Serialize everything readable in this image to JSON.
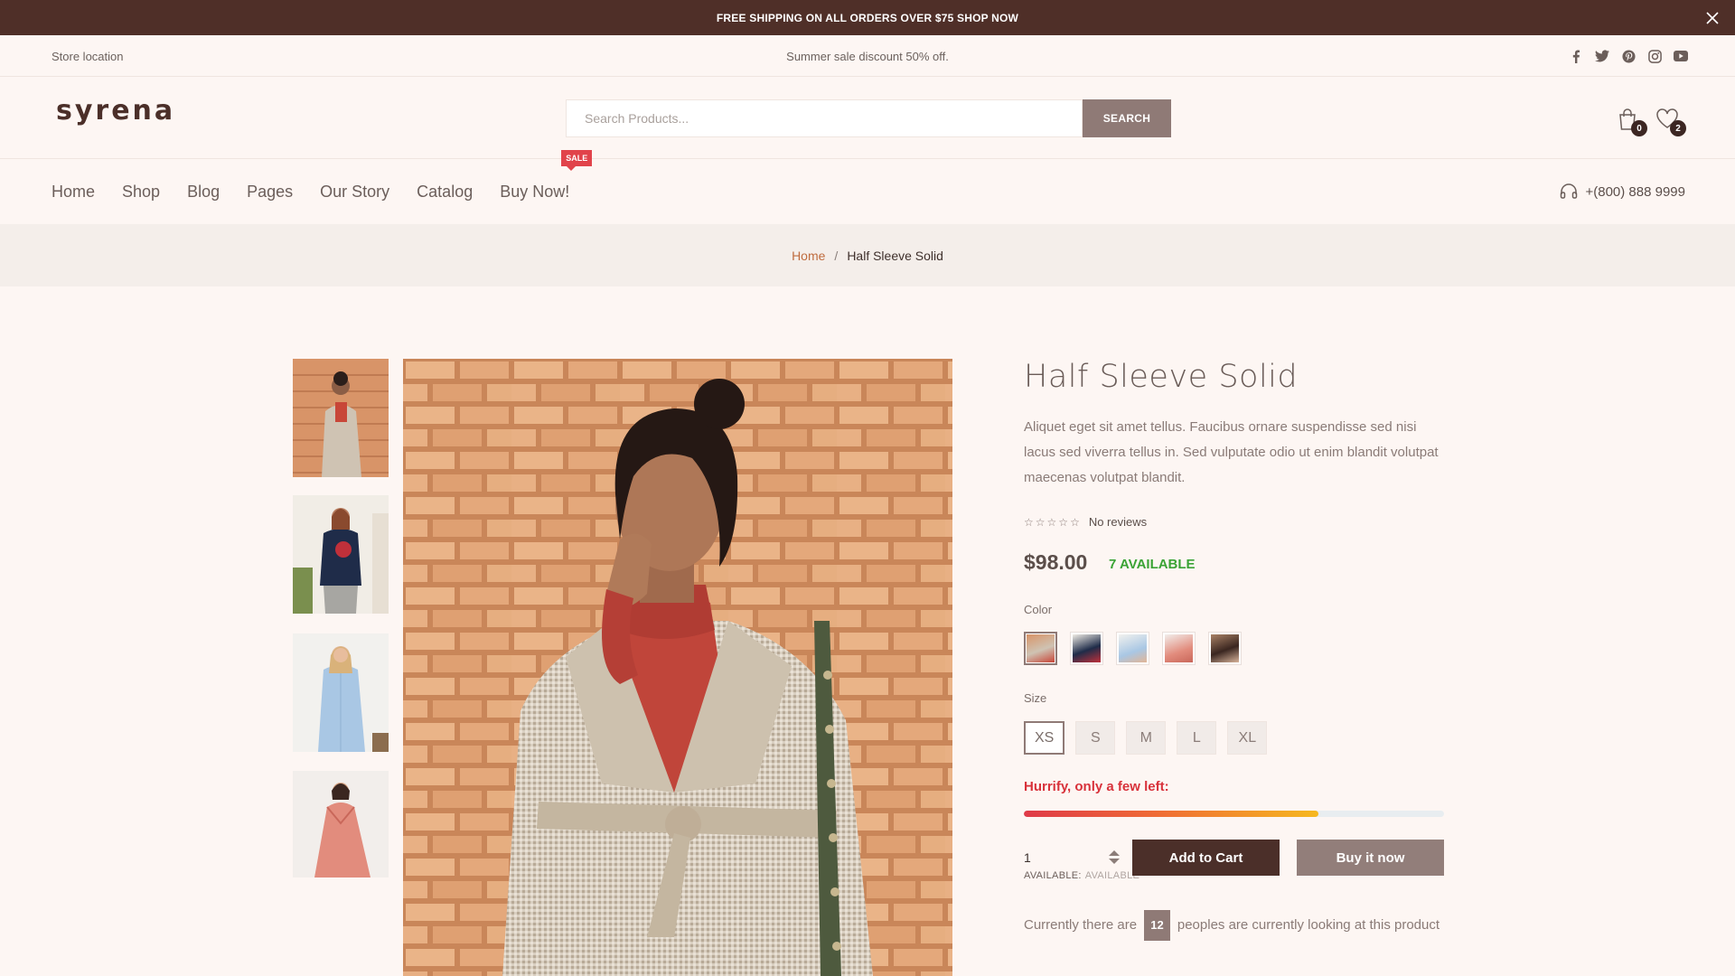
{
  "announcement": {
    "text": "FREE SHIPPING ON ALL ORDERS OVER $75 SHOP NOW",
    "close_icon": "close-icon"
  },
  "topbar": {
    "store_location": "Store location",
    "promo": "Summer sale discount 50% off.",
    "social": [
      "facebook-icon",
      "twitter-icon",
      "pinterest-icon",
      "instagram-icon",
      "youtube-icon"
    ]
  },
  "header": {
    "logo": "syrena",
    "search": {
      "placeholder": "Search Products...",
      "button": "SEARCH"
    },
    "cart_count": "0",
    "wishlist_count": "2"
  },
  "nav": {
    "items": [
      "Home",
      "Shop",
      "Blog",
      "Pages",
      "Our Story",
      "Catalog",
      "Buy Now!"
    ],
    "sale_badge": "SALE",
    "phone": "+(800) 888 9999"
  },
  "breadcrumb": {
    "home": "Home",
    "separator": "/",
    "current": "Half Sleeve Solid"
  },
  "product": {
    "title": "Half Sleeve Solid",
    "description": "Aliquet eget sit amet tellus. Faucibus ornare suspendisse sed nisi lacus sed viverra tellus in. Sed vulputate odio ut enim blandit volutpat maecenas volutpat blandit.",
    "reviews": "No reviews",
    "rating": 0,
    "price": "$98.00",
    "availability": "7 AVAILABLE",
    "color_label": "Color",
    "colors": [
      "beige coat",
      "navy sweater",
      "light blue dress",
      "coral dress",
      "dark outfit"
    ],
    "size_label": "Size",
    "sizes": [
      "XS",
      "S",
      "M",
      "L",
      "XL"
    ],
    "selected_size": "XS",
    "hurry_text": "Hurrify, only a few left:",
    "stock_level": 0.7,
    "quantity": "1",
    "availability_label": "AVAILABLE:",
    "availability_value": "AVAILABLE",
    "add_to_cart": "Add to Cart",
    "buy_now": "Buy it now",
    "watching_prefix": "Currently there are",
    "watching_count": "12",
    "watching_suffix": "peoples are currently looking at this product"
  },
  "colors": {
    "dark_brown": "#4f2f28",
    "sale_red": "#e1434b",
    "in_stock_green": "#3aa335",
    "hurry_red": "#d8323b"
  }
}
